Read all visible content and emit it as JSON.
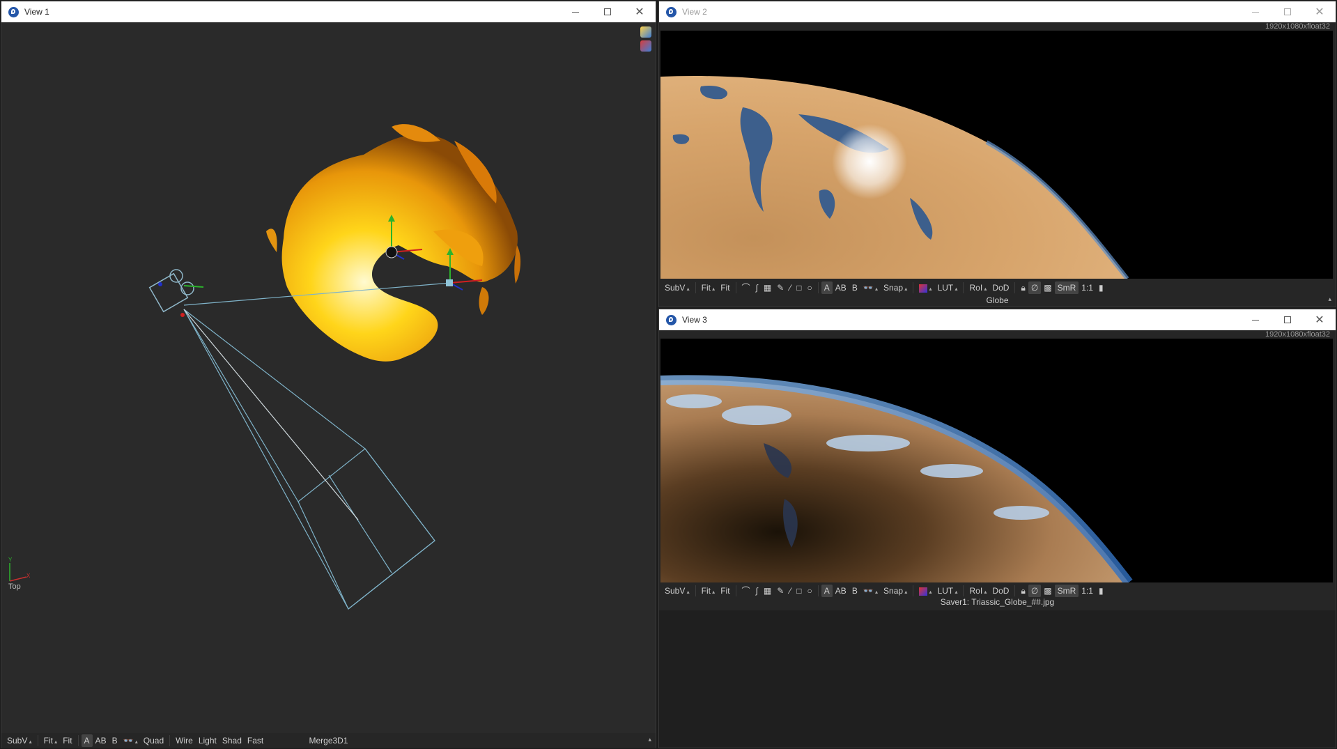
{
  "view1": {
    "title": "View 1",
    "axis_label": "Top",
    "axis_y": "Y",
    "axis_x": "X",
    "toolbar": {
      "subv": "SubV",
      "fit1": "Fit",
      "fit2": "Fit",
      "a": "A",
      "ab": "AB",
      "b": "B",
      "quad": "Quad",
      "wire": "Wire",
      "light": "Light",
      "shad": "Shad",
      "fast": "Fast"
    },
    "status": "Merge3D1"
  },
  "view2": {
    "title": "View 2",
    "resolution": "1920x1080xfloat32",
    "toolbar": {
      "subv": "SubV",
      "fit1": "Fit",
      "fit2": "Fit",
      "a": "A",
      "ab": "AB",
      "b": "B",
      "snap": "Snap",
      "lut": "LUT",
      "roi": "RoI",
      "dod": "DoD",
      "smr": "SmR",
      "ratio": "1:1"
    },
    "status": "Globe"
  },
  "view3": {
    "title": "View 3",
    "resolution": "1920x1080xfloat32",
    "toolbar": {
      "subv": "SubV",
      "fit1": "Fit",
      "fit2": "Fit",
      "a": "A",
      "ab": "AB",
      "b": "B",
      "snap": "Snap",
      "lut": "LUT",
      "roi": "RoI",
      "dod": "DoD",
      "smr": "SmR",
      "ratio": "1:1"
    },
    "status": "Saver1: Triassic_Globe_##.jpg"
  },
  "colors": {
    "accent": "#2456a8",
    "viewport": "#2a2a2a",
    "gizmo_red": "#d02020",
    "gizmo_green": "#2cb32c",
    "gizmo_blue": "#2030c8",
    "camera_line": "#7fb3c9"
  }
}
